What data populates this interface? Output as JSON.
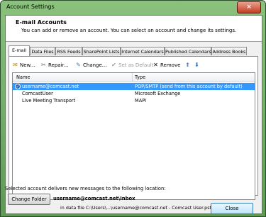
{
  "window": {
    "title": "Account Settings",
    "close_glyph": "×"
  },
  "header": {
    "title": "E-mail Accounts",
    "subtitle": "You can add or remove an account. You can select an account and change its settings."
  },
  "tabs": [
    {
      "label": "E-mail",
      "active": true
    },
    {
      "label": "Data Files"
    },
    {
      "label": "RSS Feeds"
    },
    {
      "label": "SharePoint Lists"
    },
    {
      "label": "Internet Calendars"
    },
    {
      "label": "Published Calendars"
    },
    {
      "label": "Address Books"
    }
  ],
  "toolbar": {
    "new": "New...",
    "repair": "Repair...",
    "change": "Change...",
    "set_default": "Set as Default",
    "remove": "Remove"
  },
  "list": {
    "col_name": "Name",
    "col_type": "Type",
    "rows": [
      {
        "name": "username@comcast.net",
        "type": "POP/SMTP (send from this account by default)",
        "selected": true,
        "default": true
      },
      {
        "name": "ComcastUser",
        "type": "Microsoft Exchange"
      },
      {
        "name": "Live Meeting Transport",
        "type": "MAPI"
      }
    ]
  },
  "delivery": {
    "text": "Selected account delivers new messages to the following location:",
    "change_folder": "Change Folder",
    "folder": "username@comcast.net\\Inbox",
    "data_file": "in data file C:\\Users\\...\\username@comcast.net - Comcast User.pst"
  },
  "footer": {
    "close": "Close"
  },
  "colors": {
    "accent": "#3399ff",
    "frame": "#6fad62"
  }
}
